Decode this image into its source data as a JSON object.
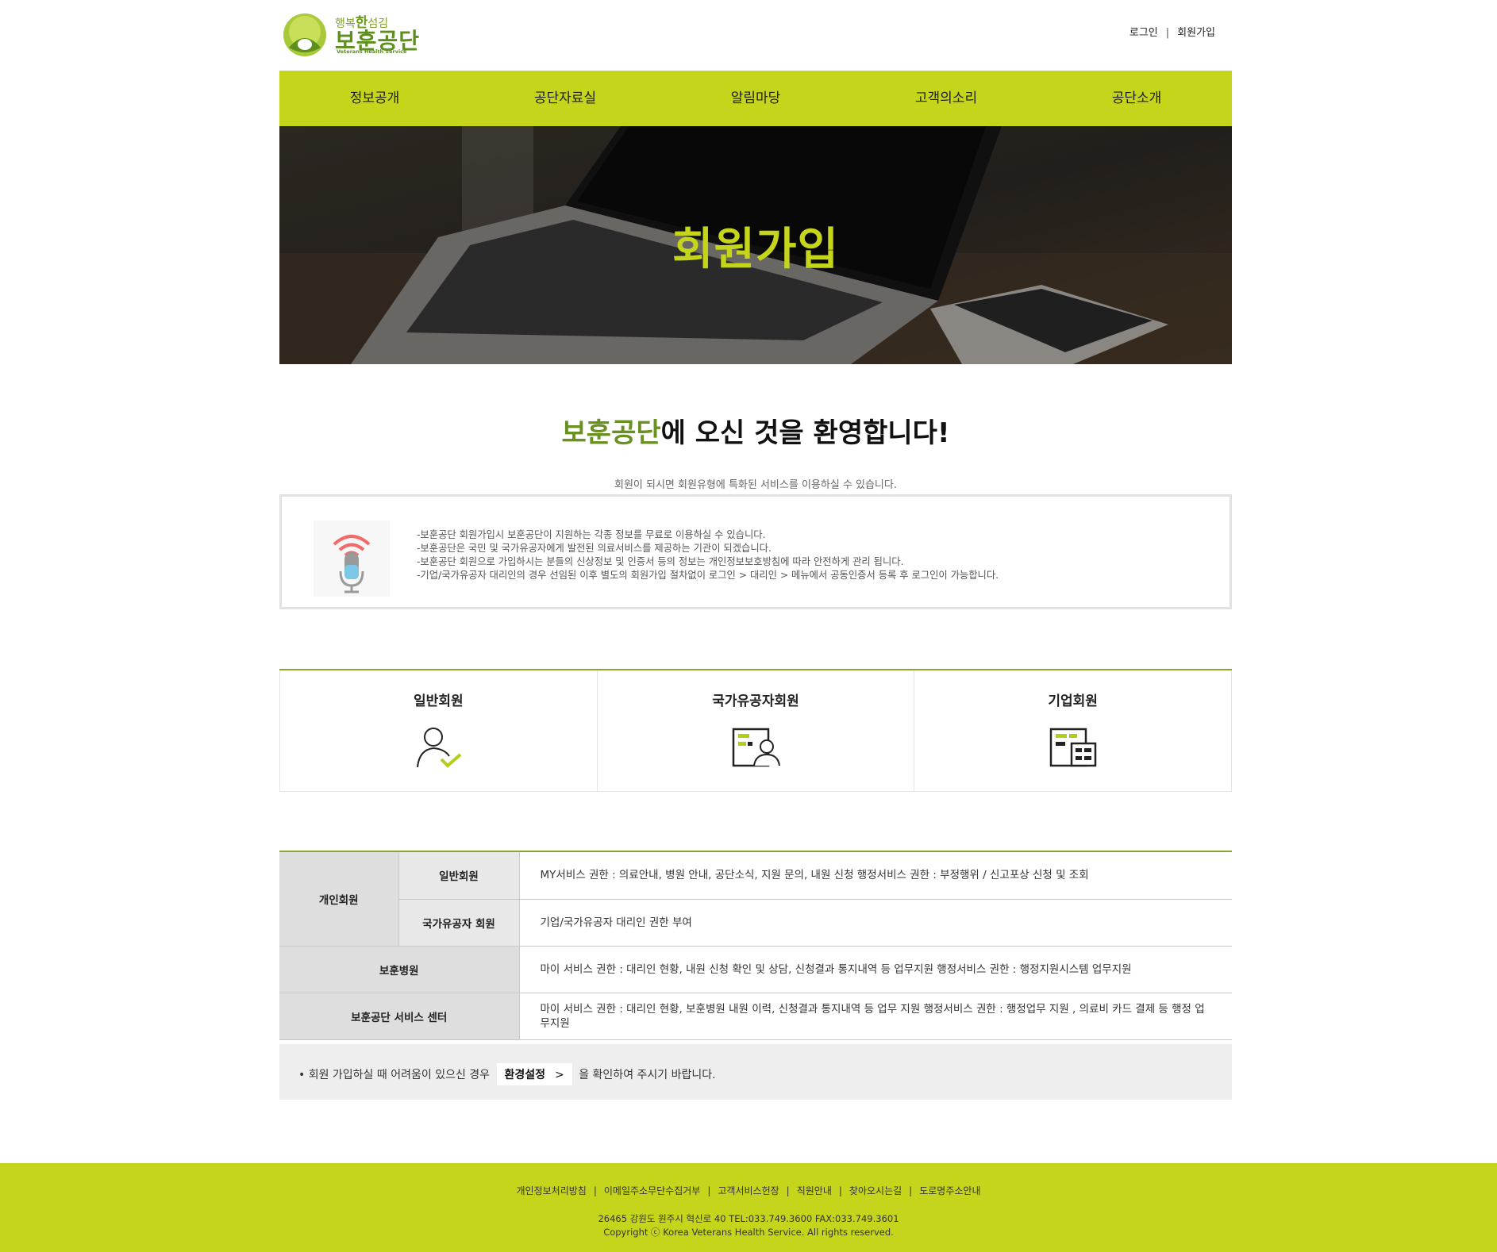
{
  "header": {
    "logo_sub_prefix": "행복",
    "logo_sub_han": "한",
    "logo_sub_suffix": "섬김",
    "logo_main": "보훈공단",
    "logo_en": "Veterans Health Service",
    "login": "로그인",
    "separator": "|",
    "signup": "회원가입"
  },
  "nav": [
    "정보공개",
    "공단자료실",
    "알림마당",
    "고객의소리",
    "공단소개"
  ],
  "hero": {
    "title": "회원가입"
  },
  "welcome": {
    "highlight": "보훈공단",
    "rest": "에 오신 것을 환영합니다!",
    "sub": "회원이 되시면 회원유형에 특화된 서비스를 이용하실 수 있습니다."
  },
  "notice": {
    "icon": "microphone-icon",
    "lines": [
      "-보훈공단 회원가입시 보훈공단이 지원하는 각종 정보를 무료로 이용하실 수 있습니다.",
      "-보훈공단은 국민 및 국가유공자에게 발전된 의료서비스를 제공하는 기관이 되겠습니다.",
      "-보훈공단 회원으로 가입하시는 분들의 신상정보 및 인증서 등의 정보는 개인정보보호방침에 따라 안전하게 관리 됩니다.",
      "-기업/국가유공자 대리인의 경우 선임된 이후 별도의 회원가입 절차없이 로그인 > 대리인 > 메뉴에서 공동인증서 등록 후 로그인이 가능합니다."
    ]
  },
  "member_types": [
    {
      "label": "일반회원",
      "icon": "person-check-icon"
    },
    {
      "label": "국가유공자회원",
      "icon": "person-card-icon"
    },
    {
      "label": "기업회원",
      "icon": "company-card-icon"
    }
  ],
  "table": {
    "group_label": "개인회원",
    "rows": [
      {
        "label": "일반회원",
        "desc": "MY서비스 권한 : 의료안내, 병원 안내, 공단소식, 지원 문의, 내원 신청 행정서비스 권한 : 부정행위 / 신고포상 신청 및 조회"
      },
      {
        "label": "국가유공자 회원",
        "desc": "기업/국가유공자 대리인 권한 부여"
      },
      {
        "label": "보훈병원",
        "desc": "마이 서비스 권한 : 대리인 현황, 내원 신청 확인 및 상담, 신청결과 통지내역 등 업무지원 행정서비스 권한 : 행정지원시스템 업무지원"
      },
      {
        "label": "보훈공단 서비스 센터",
        "desc": "마이 서비스 권한 : 대리인 현황, 보훈병원 내원 이력, 신청결과 통지내역 등 업무 지원 행정서비스 권한 : 행정업무 지원 , 의료비 카드 결제 등 행정 업무지원"
      }
    ]
  },
  "help": {
    "prefix": "• 회원 가입하실 때 어려움이 있으신 경우",
    "button": "환경설정",
    "button_arrow": ">",
    "suffix": "을 확인하여 주시기 바랍니다."
  },
  "footer": {
    "links": [
      "개인정보처리방침",
      "이메일주소무단수집거부",
      "고객서비스헌장",
      "직원안내",
      "찾아오시는길",
      "도로명주소안내"
    ],
    "separator": "|",
    "address": "26465 강원도 원주시 혁신로 40 TEL:033.749.3600 FAX:033.749.3601",
    "copyright": "Copyright ⓒ Korea Veterans Health Service. All rights reserved."
  },
  "colors": {
    "accent": "#c5d51c",
    "highlight": "#6a9022",
    "rule": "#8aa531"
  }
}
